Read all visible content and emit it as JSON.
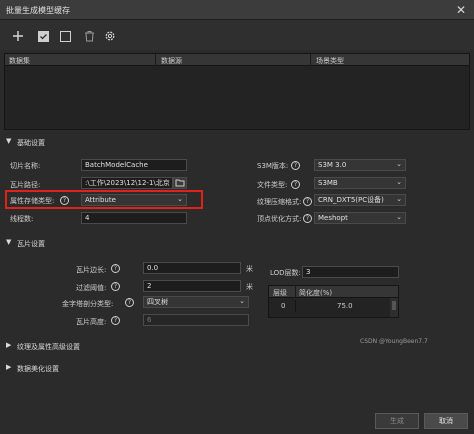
{
  "window": {
    "title": "批量生成模型缓存",
    "close_glyph": "✕"
  },
  "toolbar": {
    "icons": [
      "add-icon",
      "check-all-icon",
      "uncheck-icon",
      "delete-icon",
      "settings-icon"
    ]
  },
  "table": {
    "columns": [
      "数据集",
      "数据源",
      "场景类型"
    ]
  },
  "basic": {
    "section_label": "基础设置",
    "cache_name_label": "切片名称:",
    "cache_name_value": "BatchModelCache",
    "path_label": "瓦片路径:",
    "path_value": ":\\工作\\2023\\12\\12-1\\北京",
    "attr_storage_label": "属性存储类型:",
    "attr_storage_value": "Attribute",
    "threads_label": "线程数:",
    "threads_value": "4",
    "s3m_version_label": "S3M版本:",
    "s3m_version_value": "S3M 3.0",
    "file_type_label": "文件类型:",
    "file_type_value": "S3MB",
    "texture_compress_label": "纹理压缩格式:",
    "texture_compress_value": "CRN_DXT5(PC设备)",
    "vertex_opt_label": "顶点优化方式:",
    "vertex_opt_value": "Meshopt"
  },
  "tile": {
    "section_label": "瓦片设置",
    "tile_size_label": "瓦片边长:",
    "tile_size_value": "0.0",
    "tile_size_unit": "米",
    "filter_threshold_label": "过滤阈值:",
    "filter_threshold_value": "2",
    "filter_threshold_unit": "米",
    "pyramid_label": "金字塔剖分类型:",
    "pyramid_value": "四叉树",
    "tile_height_label": "瓦片高度:",
    "tile_height_value": "6",
    "lod_label": "LOD层数:",
    "lod_value": "3",
    "lod_table": {
      "headers": [
        "层级",
        "简化度(%)"
      ],
      "rows": [
        [
          "0",
          "75.0"
        ]
      ]
    }
  },
  "texture_section": "纹理及属性高级设置",
  "beautify_section": "数据美化设置",
  "buttons": {
    "generate": "生成",
    "cancel": "取消"
  },
  "watermark": "CSDN @YoungBeen7.7"
}
